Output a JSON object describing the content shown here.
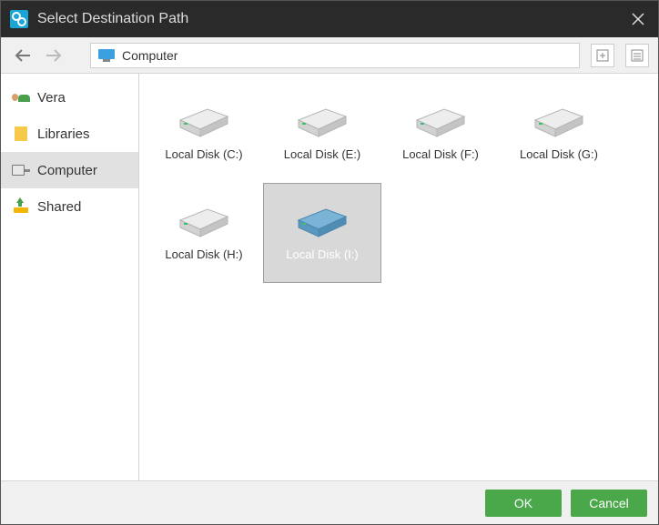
{
  "titlebar": {
    "title": "Select Destination Path"
  },
  "navbar": {
    "address_label": "Computer"
  },
  "sidebar": {
    "items": [
      {
        "label": "Vera",
        "icon": "user",
        "selected": false
      },
      {
        "label": "Libraries",
        "icon": "libraries",
        "selected": false
      },
      {
        "label": "Computer",
        "icon": "computer",
        "selected": true
      },
      {
        "label": "Shared",
        "icon": "shared",
        "selected": false
      }
    ]
  },
  "drives": [
    {
      "label": "Local Disk (C:)",
      "selected": false,
      "color": "gray"
    },
    {
      "label": "Local Disk (E:)",
      "selected": false,
      "color": "gray"
    },
    {
      "label": "Local Disk (F:)",
      "selected": false,
      "color": "gray"
    },
    {
      "label": "Local Disk (G:)",
      "selected": false,
      "color": "gray"
    },
    {
      "label": "Local Disk (H:)",
      "selected": false,
      "color": "gray"
    },
    {
      "label": "Local Disk (I:)",
      "selected": true,
      "color": "blue"
    }
  ],
  "footer": {
    "ok_label": "OK",
    "cancel_label": "Cancel"
  }
}
